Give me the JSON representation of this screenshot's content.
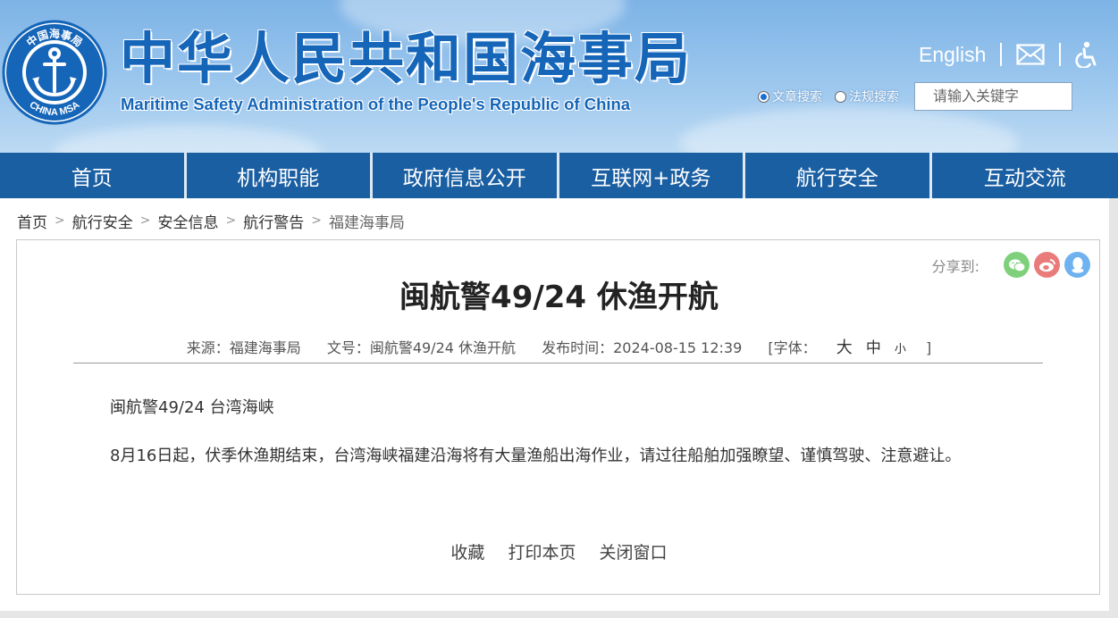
{
  "header": {
    "title_cn": "中华人民共和国海事局",
    "title_en": "Maritime Safety Administration of the People's Republic of China",
    "logo": {
      "top_text": "中国海事局",
      "bottom_text": "CHINA MSA",
      "icon": "anchor-icon"
    },
    "english_link": "English",
    "mail_icon": "mail-icon",
    "accessibility_icon": "accessibility-icon",
    "search": {
      "option_article": "文章搜索",
      "option_law": "法规搜索",
      "selected": "文章搜索",
      "placeholder": "请输入关键字"
    }
  },
  "nav": {
    "items": [
      "首页",
      "机构职能",
      "政府信息公开",
      "互联网+政务",
      "航行安全",
      "互动交流"
    ]
  },
  "breadcrumb": {
    "items": [
      "首页",
      "航行安全",
      "安全信息",
      "航行警告",
      "福建海事局"
    ]
  },
  "article": {
    "share_label": "分享到:",
    "share_icons": [
      "wechat-icon",
      "weibo-icon",
      "qq-icon"
    ],
    "title": "闽航警49/24 休渔开航",
    "meta": {
      "source": "来源：福建海事局",
      "doc_no": "文号：闽航警49/24 休渔开航",
      "publish_time": "发布时间：2024-08-15 12:39",
      "font_label": "[字体：",
      "font_big": "大",
      "font_mid": "中",
      "font_small": "小",
      "font_close": "]"
    },
    "paragraph1": "闽航警49/24 台湾海峡",
    "paragraph2": "8月16日起，伏季休渔期结束，台湾海峡福建沿海将有大量渔船出海作业，请过往船舶加强瞭望、谨慎驾驶、注意避让。",
    "actions": [
      "收藏",
      "打印本页",
      "关闭窗口"
    ]
  },
  "colors": {
    "brand_blue": "#1565b8",
    "nav_blue": "#1b5fa3",
    "wechat_green": "#7ed07b",
    "weibo_red": "#ea7b7b",
    "qq_blue": "#6fb2ef"
  }
}
